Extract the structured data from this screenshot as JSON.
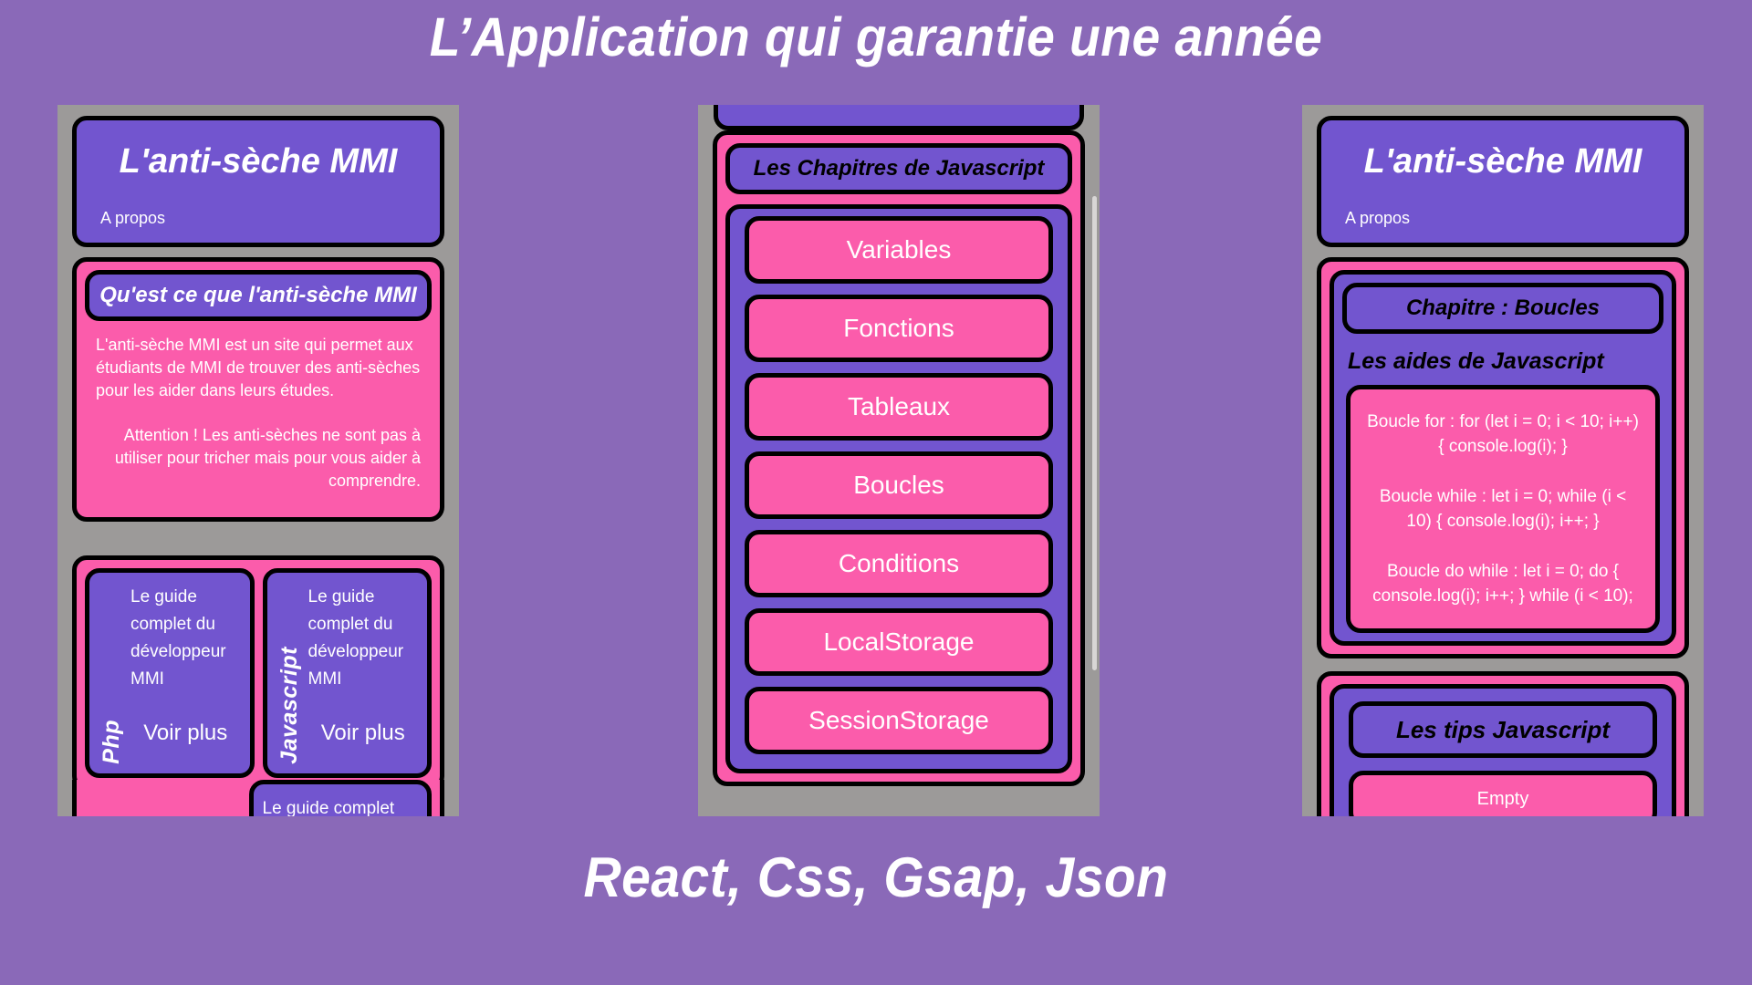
{
  "banner": {
    "title": "L’Application qui garantie une année",
    "footer": "React, Css, Gsap, Json"
  },
  "colors": {
    "background": "#8a69b8",
    "phone_frame": "#9c9a99",
    "purple": "#7255cf",
    "pink": "#fb5cab",
    "outline": "#000000",
    "text_light": "#ffffff",
    "text_dark": "#000000"
  },
  "phones": {
    "left": {
      "header": {
        "title": "L'anti-sèche MMI",
        "subtitle": "A propos"
      },
      "about": {
        "section_title": "Qu'est ce que l'anti-sèche MMI",
        "paragraph_1": "L'anti-sèche MMI est un site qui permet aux étudiants de MMI de trouver des anti-sèches pour les aider dans leurs études.",
        "paragraph_2": "Attention ! Les anti-sèches ne sont pas à utiliser pour tricher mais pour vous aider à comprendre."
      },
      "guides": [
        {
          "lang": "Php",
          "text": "Le guide complet du développeur MMI",
          "more": "Voir plus"
        },
        {
          "lang": "Javascript",
          "text": "Le guide complet du développeur MMI",
          "more": "Voir plus"
        }
      ],
      "guides_row2": [
        {
          "lang": "",
          "text": "Le guide complet du",
          "more": ""
        }
      ]
    },
    "middle": {
      "section_title": "Les Chapitres de Javascript",
      "chapters": [
        "Variables",
        "Fonctions",
        "Tableaux",
        "Boucles",
        "Conditions",
        "LocalStorage",
        "SessionStorage"
      ]
    },
    "right": {
      "header": {
        "title": "L'anti-sèche MMI",
        "subtitle": "A propos"
      },
      "chapter": {
        "section_title": "Chapitre : Boucles",
        "aides_title": "Les aides de Javascript",
        "code_lines": [
          "Boucle for : for (let i = 0; i < 10; i++) { console.log(i); }",
          "Boucle while : let i = 0; while (i < 10) { console.log(i); i++; }",
          "Boucle do while : let i = 0; do { console.log(i); i++; } while (i < 10);"
        ]
      },
      "tips": {
        "title": "Les tips Javascript",
        "empty_label": "Empty"
      }
    }
  }
}
